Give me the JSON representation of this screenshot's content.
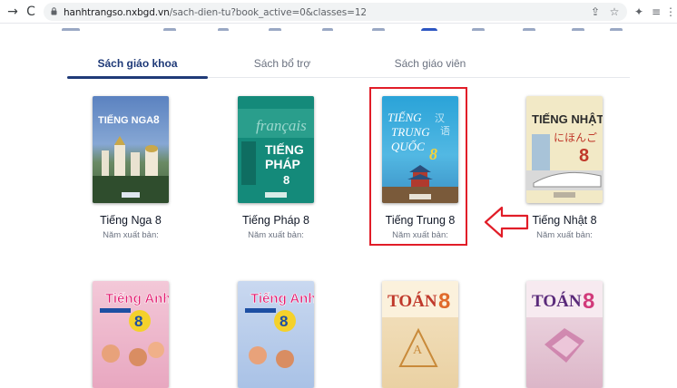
{
  "browser": {
    "url_host": "hanhtrangso.nxbgd.vn",
    "url_path": "/sach-dien-tu?book_active=0&classes=12",
    "icons": [
      "back-arrow-icon",
      "reload-icon",
      "lock-icon",
      "share-icon",
      "star-icon",
      "extensions-icon",
      "reading-list-icon",
      "menu-icon"
    ]
  },
  "tabs": [
    {
      "label": "Sách giáo khoa",
      "active": true
    },
    {
      "label": "Sách bổ trợ",
      "active": false
    },
    {
      "label": "Sách giáo viên",
      "active": false
    }
  ],
  "books_row1": [
    {
      "title": "Tiếng Nga 8",
      "sub": "Năm xuất bản:",
      "cover_text": "TIẾNG NGA 8"
    },
    {
      "title": "Tiếng Pháp 8",
      "sub": "Năm xuất bản:",
      "cover_text": "TIẾNG PHÁP"
    },
    {
      "title": "Tiếng Trung 8",
      "sub": "Năm xuất bản:",
      "cover_text": "TIẾNG TRUNG QUỐC"
    },
    {
      "title": "Tiếng Nhật 8",
      "sub": "Năm xuất bản:",
      "cover_text": "TIẾNG NHẬT"
    }
  ],
  "books_row2_covers": [
    "Tiếng Anh",
    "Tiếng Anh",
    "TOÁN",
    "TOÁN"
  ],
  "colors": {
    "accent": "#1f3a78",
    "highlight": "#e11d28"
  }
}
